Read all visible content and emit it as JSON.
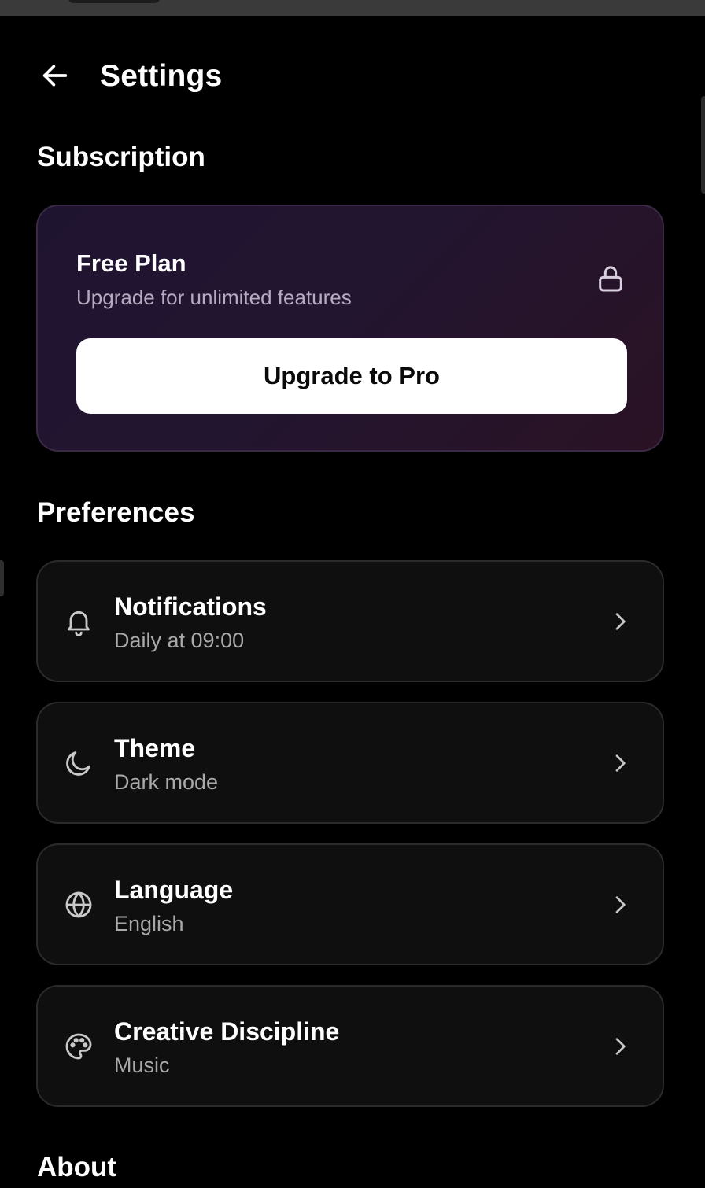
{
  "header": {
    "title": "Settings",
    "back_icon": "arrow-left-icon"
  },
  "subscription": {
    "section_title": "Subscription",
    "plan_name": "Free Plan",
    "plan_description": "Upgrade for unlimited features",
    "status_icon": "lock-icon",
    "upgrade_label": "Upgrade to Pro"
  },
  "preferences": {
    "section_title": "Preferences",
    "items": [
      {
        "label": "Notifications",
        "value": "Daily at 09:00",
        "icon": "bell-icon"
      },
      {
        "label": "Theme",
        "value": "Dark mode",
        "icon": "moon-icon"
      },
      {
        "label": "Language",
        "value": "English",
        "icon": "globe-icon"
      },
      {
        "label": "Creative Discipline",
        "value": "Music",
        "icon": "palette-icon"
      }
    ]
  },
  "about": {
    "section_title": "About"
  },
  "colors": {
    "background": "#000000",
    "card": "#0f0f0f",
    "card_border": "#2b2b2b",
    "subscription_gradient_start": "#1f1430",
    "subscription_gradient_end": "#2a1224",
    "secondary_text": "#a9a9a9"
  }
}
